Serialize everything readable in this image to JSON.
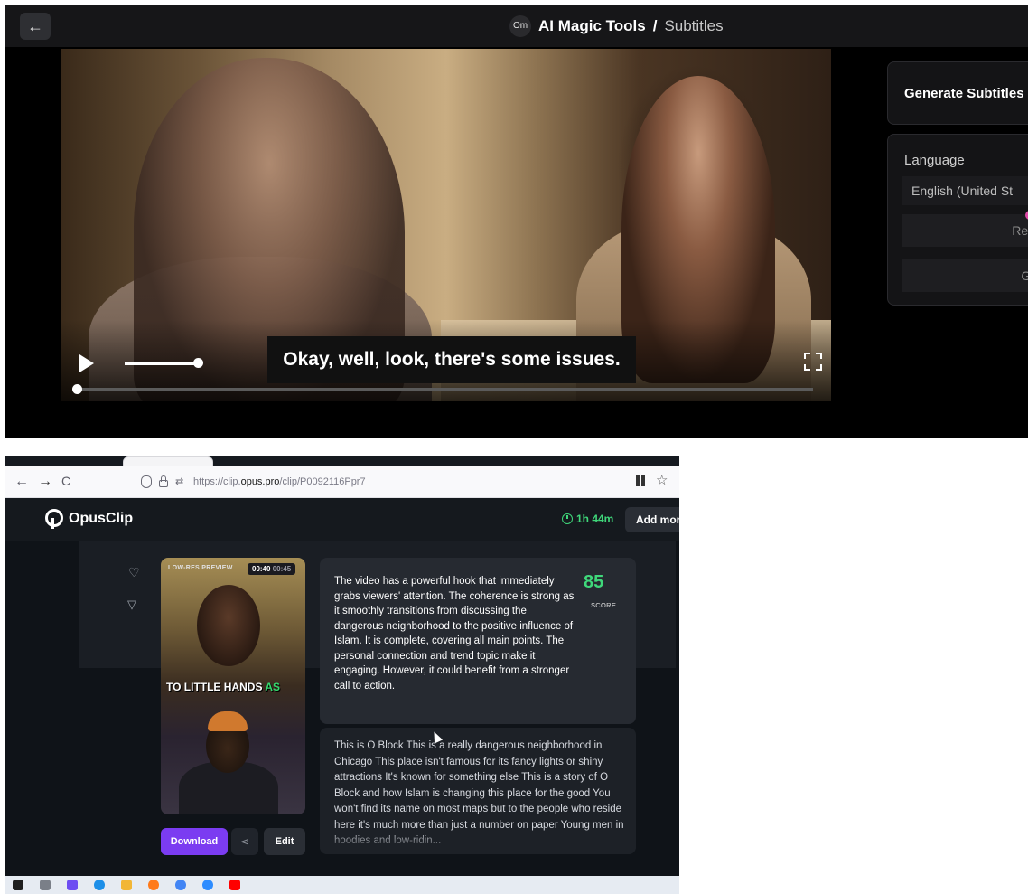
{
  "top_app": {
    "back_glyph": "←",
    "logo_text": "Om",
    "title": "AI Magic Tools",
    "title_separator": "/",
    "subtitle": "Subtitles",
    "video": {
      "subtitle_text": "Okay, well, look, there's some issues.",
      "progress_fraction": 0.0,
      "volume_fraction": 1.0
    },
    "panel": {
      "heading": "Generate Subtitles",
      "language_label": "Language",
      "language_value": "English (United St",
      "replace_button": "Repl",
      "generate_button": "Ge"
    }
  },
  "browser": {
    "nav": {
      "back": "←",
      "forward": "→",
      "reload": "C"
    },
    "url_prefix": "https://clip.",
    "url_host": "opus.pro",
    "url_path": "/clip/P0092116Ppr7",
    "permissions_glyph": "⇄",
    "bookmark_glyph": "☆"
  },
  "opus": {
    "brand": "OpusClip",
    "credits": "1h 44m",
    "add_more_button": "Add more",
    "clip": {
      "preview_badge": "LOW-RES PREVIEW",
      "time_current": "00:40",
      "time_duration": "00:45",
      "caption_main": "TO LITTLE HANDS",
      "caption_highlight": "AS",
      "download_button": "Download",
      "share_glyph": "⋖",
      "edit_button": "Edit",
      "heart_glyph": "♡",
      "dislike_glyph": "▽"
    },
    "score": {
      "value": "85",
      "label": "SCORE",
      "text": "The video has a powerful hook that immediately grabs viewers' attention. The coherence is strong as it smoothly transitions from discussing the dangerous neighborhood to the positive influence of Islam. It is complete, covering all main points. The personal connection and trend topic make it engaging. However, it could benefit from a stronger call to action."
    },
    "transcript": "This is O Block This is a really dangerous neighborhood in Chicago This place isn't famous for its fancy lights or shiny attractions It's known for something else This is a story of O Block and how Islam is changing this place for the good You won't find its name on most maps but to the people who reside here it's much more than just a number on paper Young men in hoodies and low-ridin..."
  },
  "taskbar": {
    "icons": [
      "windows-icon",
      "task-view-icon",
      "app-icon-1",
      "edge-icon",
      "file-explorer-icon",
      "firefox-icon",
      "chrome-icon",
      "zoom-icon",
      "youtube-icon"
    ],
    "icon_colors": [
      "#1e1e1e",
      "#7a7f88",
      "#6d4df2",
      "#1d8fe8",
      "#f2b636",
      "#ff7a1a",
      "#4285f4",
      "#2d8cff",
      "#ff0000"
    ]
  }
}
